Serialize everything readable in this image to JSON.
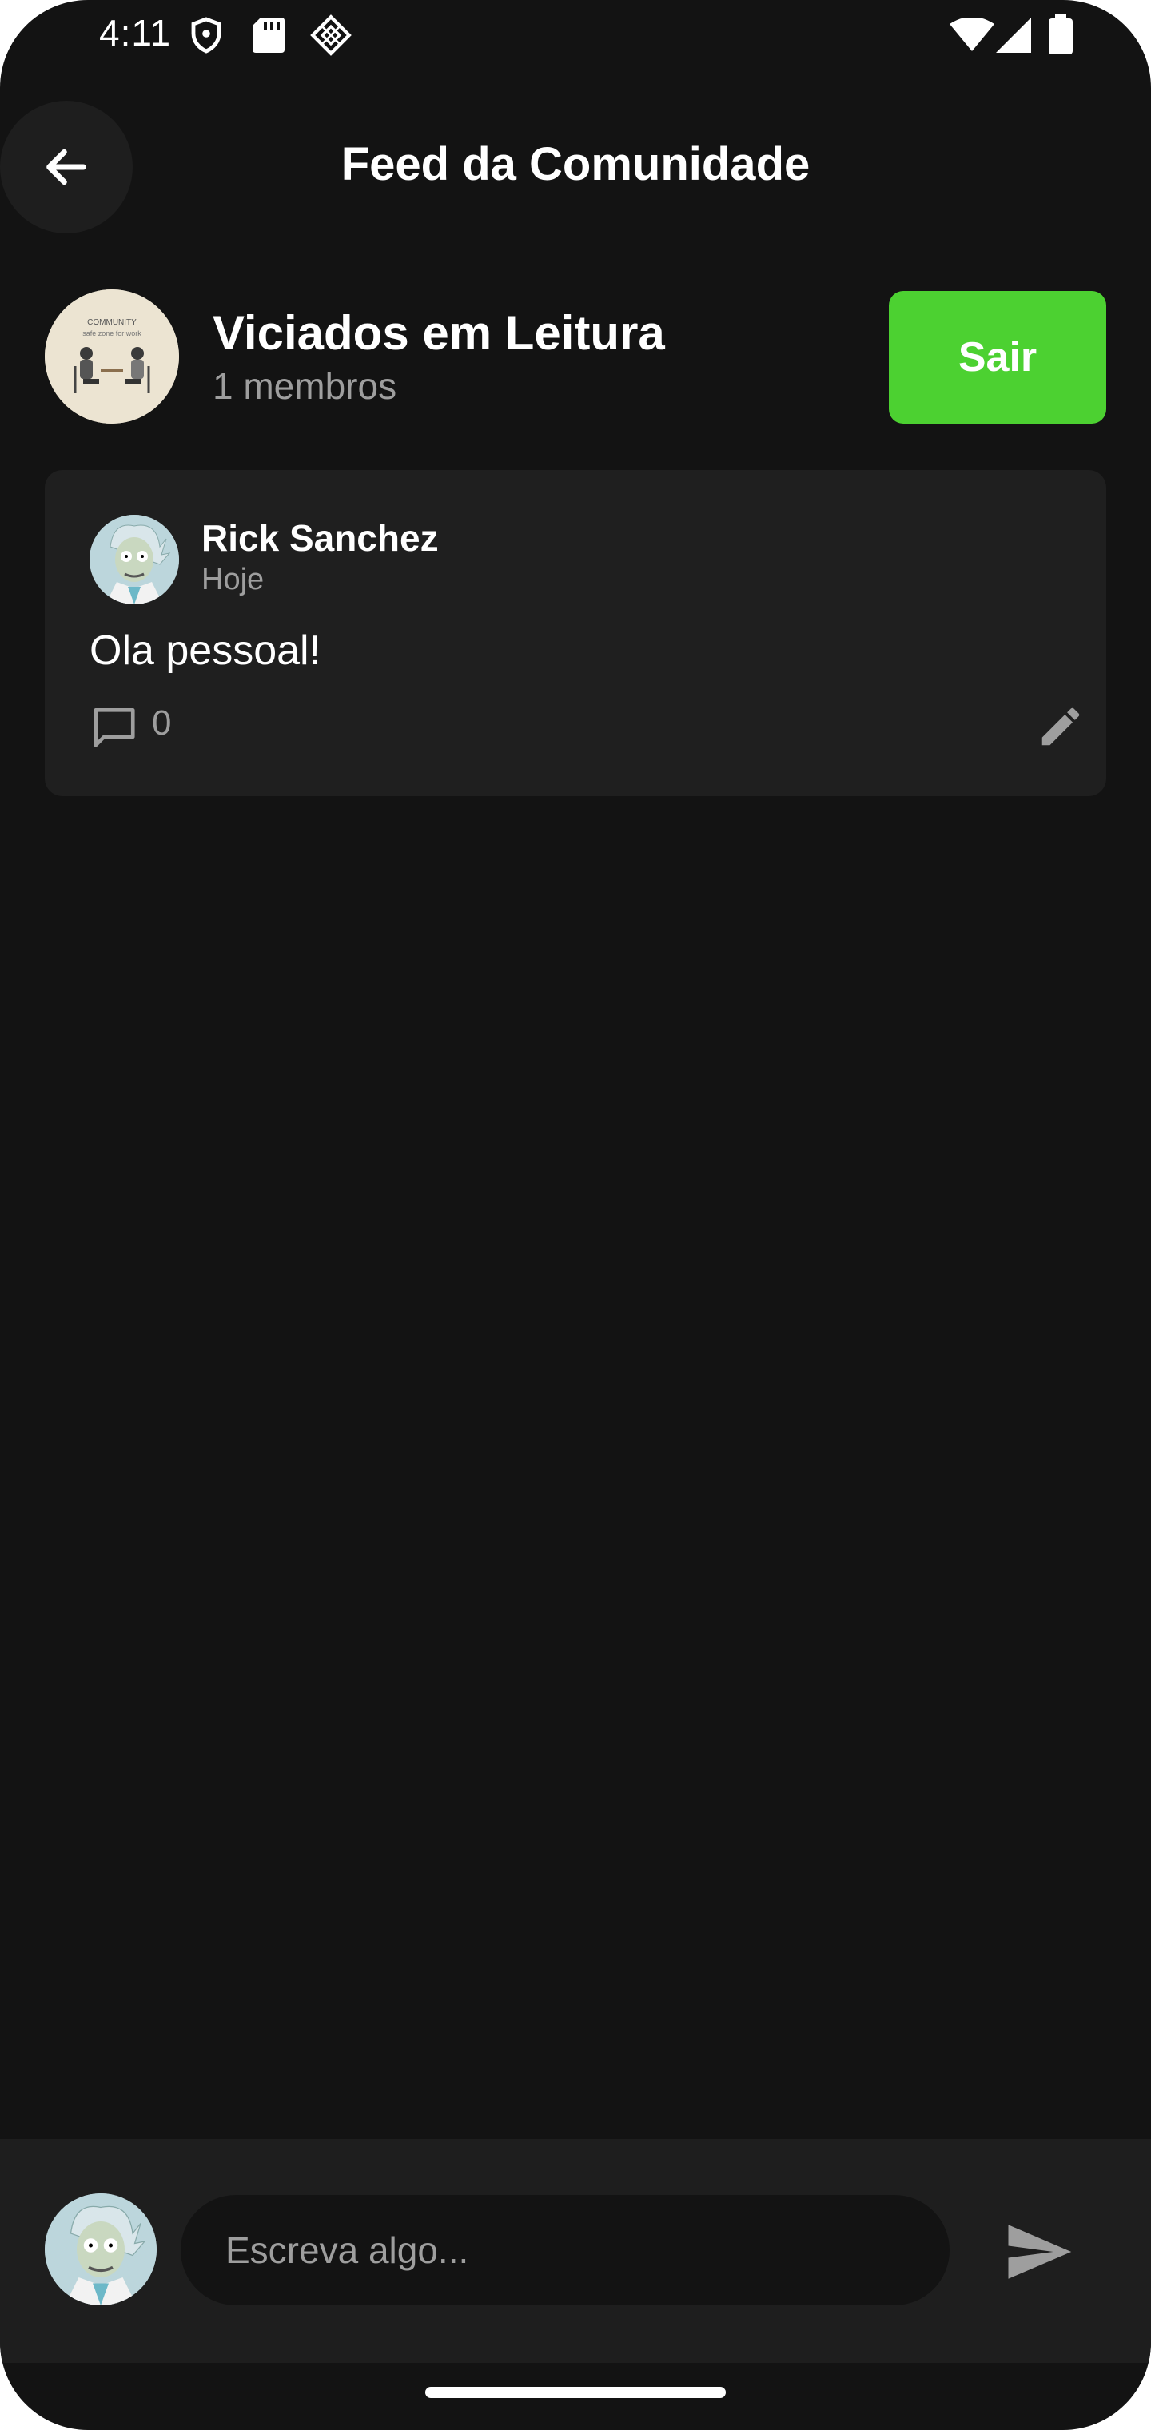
{
  "status_bar": {
    "time": "4:11",
    "left_icons": [
      "shield-icon",
      "sd-card-icon",
      "app-notification-icon"
    ],
    "right_icons": [
      "wifi-icon",
      "signal-icon",
      "battery-icon"
    ]
  },
  "header": {
    "title": "Feed da Comunidade",
    "back_icon": "arrow-left-icon"
  },
  "community": {
    "name": "Viciados em Leitura",
    "members": "1 membros",
    "leave_label": "Sair",
    "avatar_caption_line1": "COMMUNITY",
    "avatar_caption_line2": "safe zone for work"
  },
  "posts": [
    {
      "author": "Rick Sanchez",
      "time": "Hoje",
      "text": "Ola pessoal!",
      "comment_count": "0",
      "comment_icon": "comment-icon",
      "edit_icon": "pencil-icon"
    }
  ],
  "composer": {
    "placeholder": "Escreva algo...",
    "send_icon": "send-icon"
  },
  "colors": {
    "background": "#131313",
    "card": "#1f1f1f",
    "accent_green": "#4cd131",
    "muted_text": "#9e9e9e"
  }
}
